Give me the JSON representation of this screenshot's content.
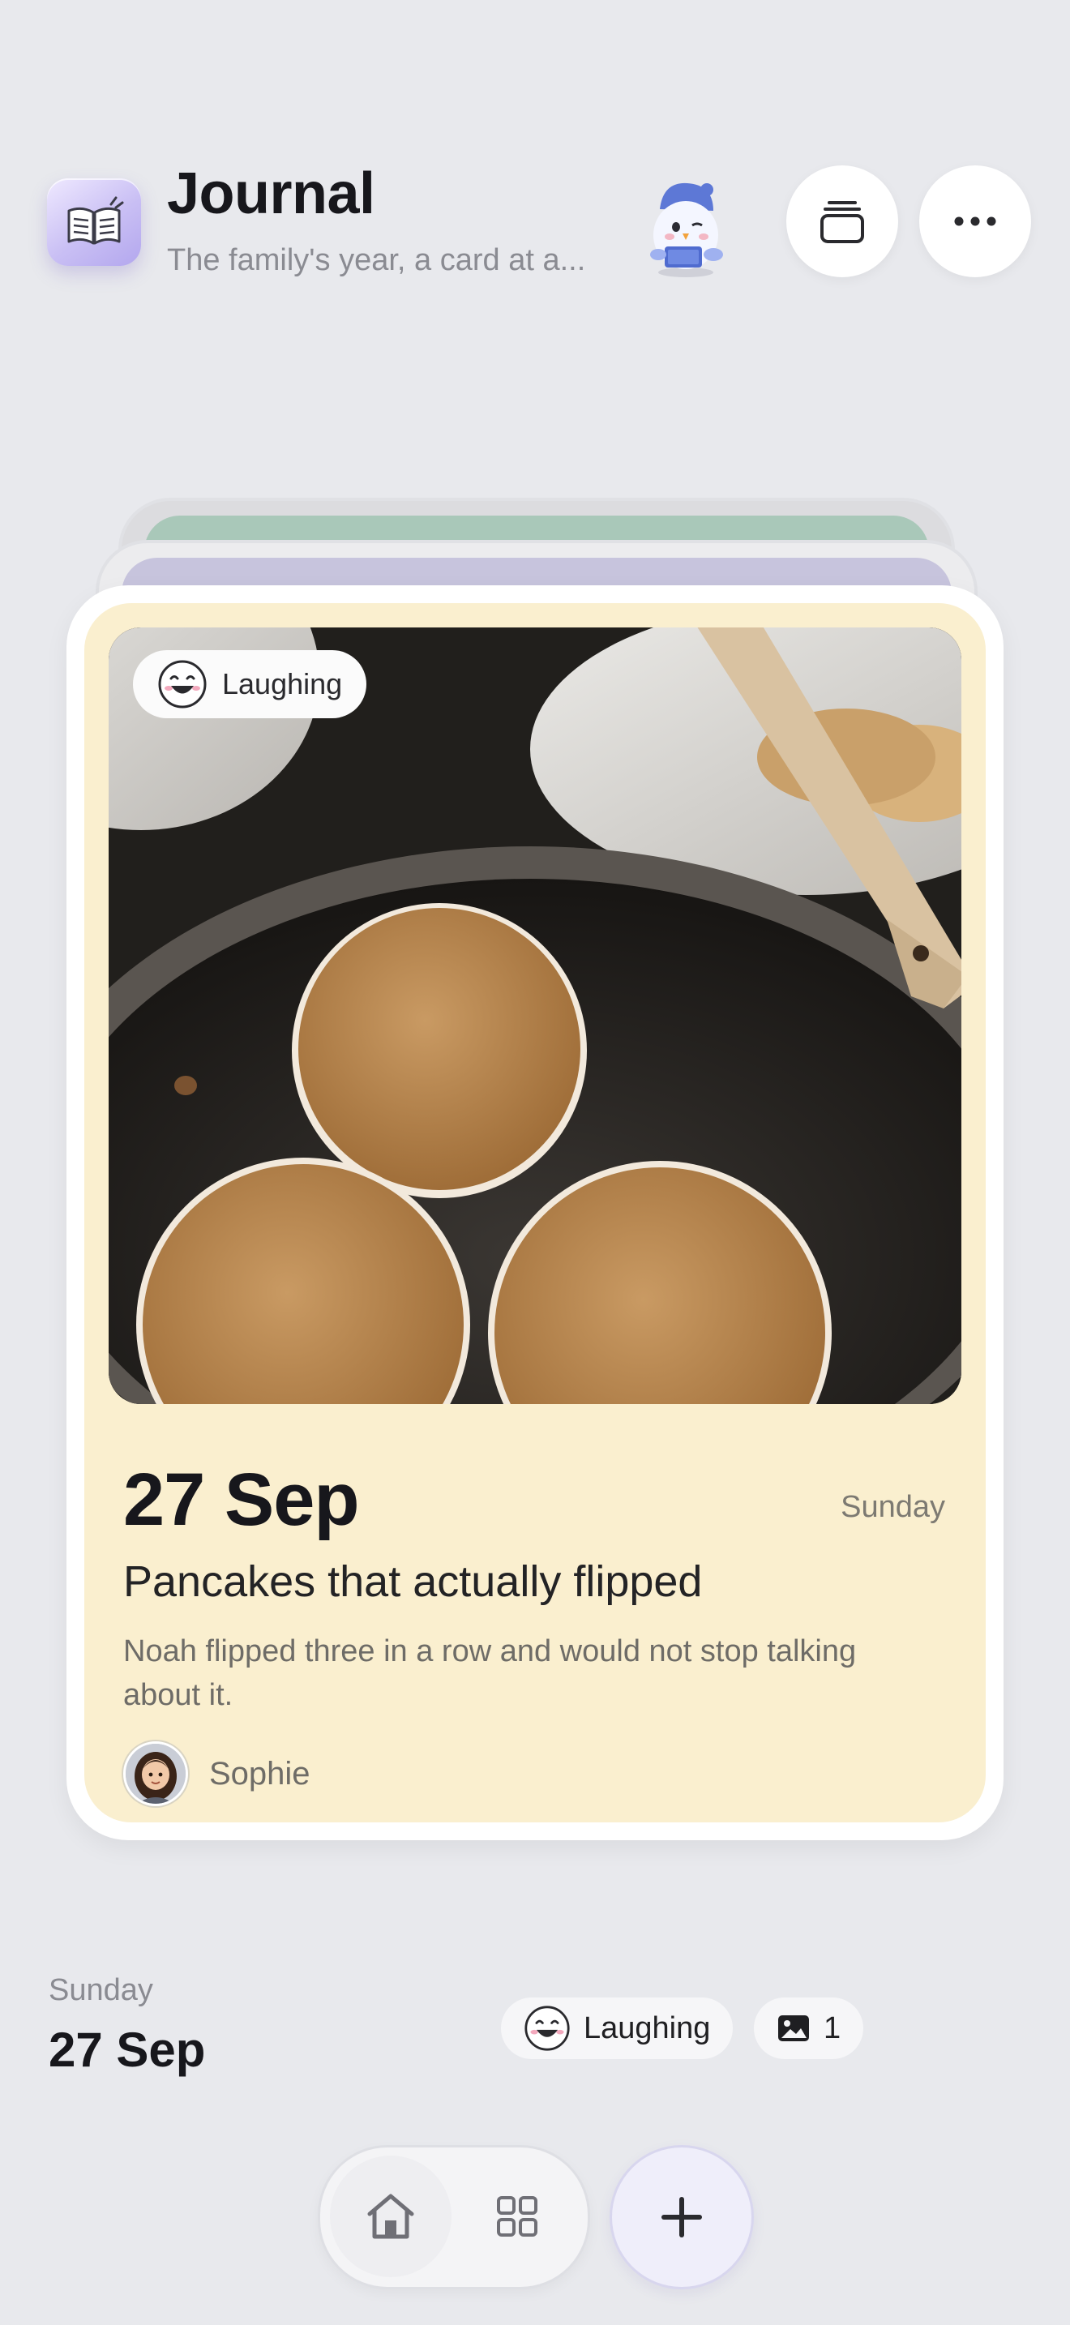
{
  "header": {
    "title": "Journal",
    "subtitle": "The family's year, a card at a..."
  },
  "card": {
    "mood_label": "Laughing",
    "date": "27 Sep",
    "weekday": "Sunday",
    "title": "Pancakes that actually flipped",
    "body": "Noah flipped three in a row and would not stop talking about it.",
    "author": "Sophie"
  },
  "summary": {
    "weekday": "Sunday",
    "date": "27 Sep",
    "mood_label": "Laughing",
    "photo_count": "1"
  },
  "colors": {
    "background": "#e8e9ed",
    "card_fill": "#faefcf",
    "accent": "#b3a7ee"
  },
  "icons": {
    "app": "book-icon",
    "stack": "stack-icon",
    "more": "more-icon",
    "home": "home-icon",
    "grid": "grid-icon",
    "add": "plus-icon",
    "photos": "image-icon",
    "mood": "laughing-face-icon"
  }
}
